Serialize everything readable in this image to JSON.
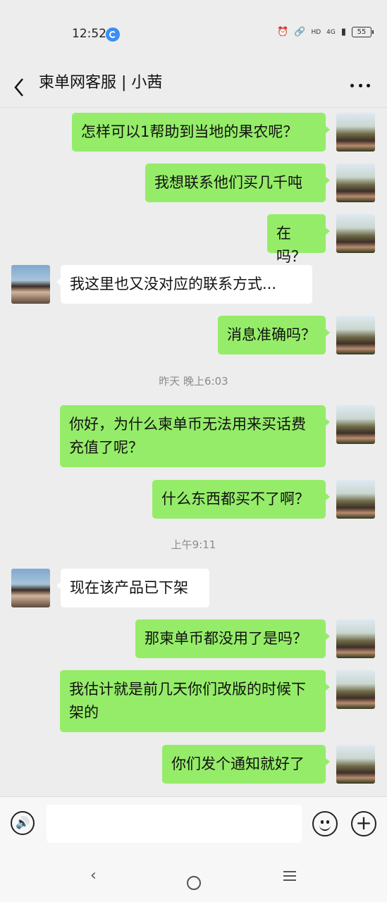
{
  "status_bar": {
    "time": "12:52",
    "network": "4G",
    "hd_label": "HD",
    "battery": "55",
    "icons": [
      "alarm-icon",
      "link-icon",
      "signal-icon",
      "battery-icon"
    ]
  },
  "header": {
    "title": "柬单网客服 | 小茜",
    "icons": [
      "back-arrow-icon",
      "more-dots-icon"
    ]
  },
  "messages": [
    {
      "from": "me",
      "text": "怎样可以1帮助到当地的果农呢？"
    },
    {
      "from": "me",
      "text": "我想联系他们买几千吨"
    },
    {
      "from": "me",
      "text": "在吗？"
    },
    {
      "from": "them",
      "text": "我这里也又没对应的联系方式..."
    },
    {
      "from": "me",
      "text": "消息准确吗？"
    },
    {
      "from": "me",
      "text": "你好，为什么柬单币无法用来买话费充值了呢？"
    },
    {
      "from": "me",
      "text": "什么东西都买不了啊？"
    },
    {
      "from": "them",
      "text": "现在该产品已下架"
    },
    {
      "from": "me",
      "text": "那柬单币都没用了是吗？"
    },
    {
      "from": "me",
      "text": "我估计就是前几天你们改版的时候下架的"
    },
    {
      "from": "me",
      "text": "你们发个通知就好了"
    }
  ],
  "timestamps": [
    "昨天 晚上6:03",
    "上午9:11"
  ],
  "input_bar": {
    "value": "",
    "icons": [
      "voice-icon",
      "emoji-icon",
      "plus-icon"
    ]
  },
  "system_nav": {
    "icons": [
      "back-icon",
      "home-icon",
      "menu-icon"
    ]
  },
  "colors": {
    "background": "#ededed",
    "my_bubble": "#95ec69",
    "their_bubble": "#ffffff"
  }
}
